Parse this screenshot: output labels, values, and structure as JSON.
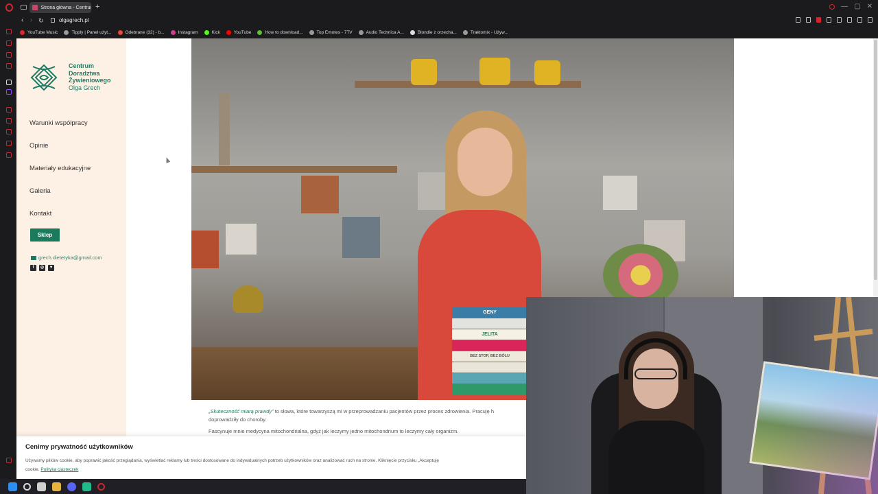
{
  "browser": {
    "tab_title": "Strona główna - Centrum",
    "new_tab_symbol": "+",
    "url": "olgagrech.pl",
    "bookmarks": [
      {
        "label": "YouTube Music",
        "color": "#e0262b"
      },
      {
        "label": "Tipply | Panel użyt...",
        "color": "#9a9a9a"
      },
      {
        "label": "Odebrane (32) - b...",
        "color": "#e04b3a"
      },
      {
        "label": "Instagram",
        "color": "#d63d8e"
      },
      {
        "label": "Kick",
        "color": "#53fc18"
      },
      {
        "label": "YouTube",
        "color": "#ff0000"
      },
      {
        "label": "How to download...",
        "color": "#5bc236"
      },
      {
        "label": "Top Emotes - 7TV",
        "color": "#9a9a9a"
      },
      {
        "label": "Audio Technica A...",
        "color": "#9a9a9a"
      },
      {
        "label": "Blondie z orzecha...",
        "color": "#dddddd"
      },
      {
        "label": "Traktomix - Używ...",
        "color": "#9a9a9a"
      }
    ]
  },
  "site": {
    "logo": {
      "line1": "Centrum",
      "line2": "Doradztwa",
      "line3": "Żywieniowego",
      "line4": "Olga Grech"
    },
    "menu": [
      "Warunki współpracy",
      "Opinie",
      "Materiały edukacyjne",
      "Galeria",
      "Kontakt"
    ],
    "shop_button": "Sklep",
    "email": "grech.dietetyka@gmail.com",
    "socials": [
      "f",
      "◎",
      "♥"
    ],
    "body_text": {
      "quote": "„Skuteczność miarą prawdy”",
      "p1_rest": " to słowa, które towarzyszą mi w przeprowadzaniu pacjentów przez proces zdrowienia. Pracuję h",
      "p1_line2": "doprowadziły do choroby.",
      "p2": "Fascynuje mnie medycyna mitochondrialna, gdyż jak leczymy jedno mitochondrium to leczymy cały organizm."
    },
    "books": [
      "GENY",
      "",
      "JELITA",
      "",
      "BEZ STOP, BEZ BÓLU",
      "",
      "",
      ""
    ],
    "cookie": {
      "title": "Cenimy prywatność użytkowników",
      "text": "Używamy plików cookie, aby poprawić jakość przeglądania, wyświetlać reklamy lub treści dostosowane do indywidualnych potrzeb użytkowników oraz analizować ruch na stronie. Kliknięcie przycisku „Akceptuję",
      "text2": "cookie.",
      "link": "Polityka ciasteczek"
    }
  },
  "colors": {
    "brand_green": "#1f7a63",
    "panel_bg": "#fdf1e6",
    "opera_red": "#d4252e"
  }
}
